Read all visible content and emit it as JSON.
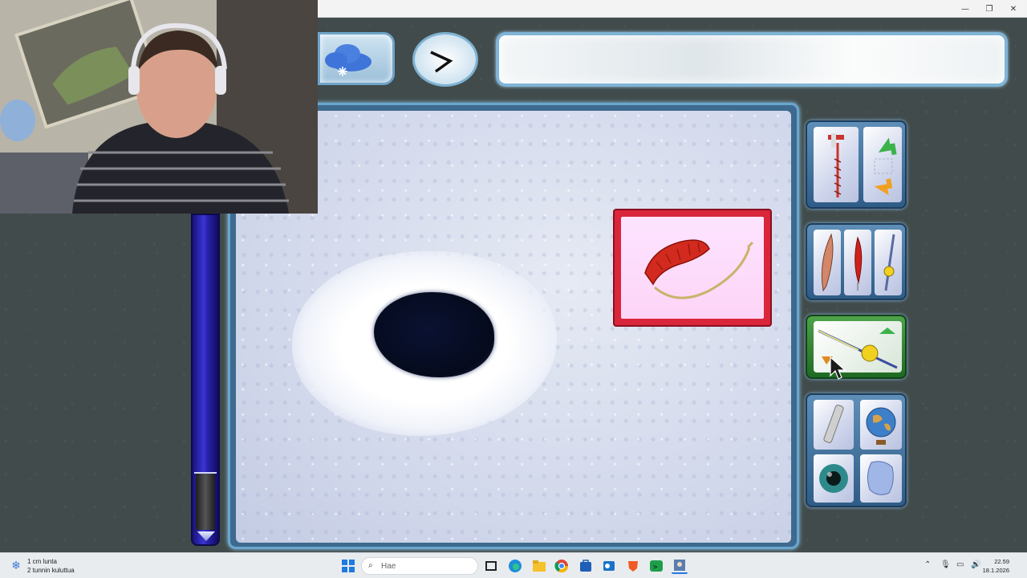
{
  "window": {
    "minimize_glyph": "—",
    "maximize_glyph": "❐",
    "close_glyph": "✕"
  },
  "game": {
    "weather_icon": "snow-cloud-icon",
    "clock_icon": "clock-hands-icon",
    "message": "",
    "current_bait_icon": "worm-on-hook-icon",
    "depth_level_fraction": 0.78,
    "tool_panels": [
      {
        "name": "drill-and-move",
        "items": [
          "ice-drill-icon",
          "move-arrows-icon"
        ]
      },
      {
        "name": "lures",
        "items": [
          "knife-icon",
          "red-lure-icon",
          "ice-rod-icon"
        ]
      },
      {
        "name": "rod",
        "items": [
          "fishing-rod-reel-icon"
        ]
      },
      {
        "name": "extras",
        "items": [
          "flashlight-icon",
          "globe-icon",
          "eye-icon",
          "ice-map-icon"
        ]
      }
    ]
  },
  "taskbar": {
    "weather_line1": "1 cm lunta",
    "weather_line2": "2 tunnin kuluttua",
    "search_placeholder": "Hae",
    "time": "22.59",
    "date": "18.1.2026",
    "tray_chevron": "⌃",
    "apps": [
      "start-icon",
      "search-icon",
      "task-view-icon",
      "edge-icon",
      "file-explorer-icon",
      "chrome-icon",
      "store-icon",
      "outlook-icon",
      "brave-icon",
      "terminal-icon",
      "game-app-icon"
    ]
  },
  "colors": {
    "panel_blue": "#3f6f99",
    "bait_card_red": "#d9263b",
    "depth_bar_indigo": "#2a24b0",
    "taskbar": "#e9ecef"
  }
}
